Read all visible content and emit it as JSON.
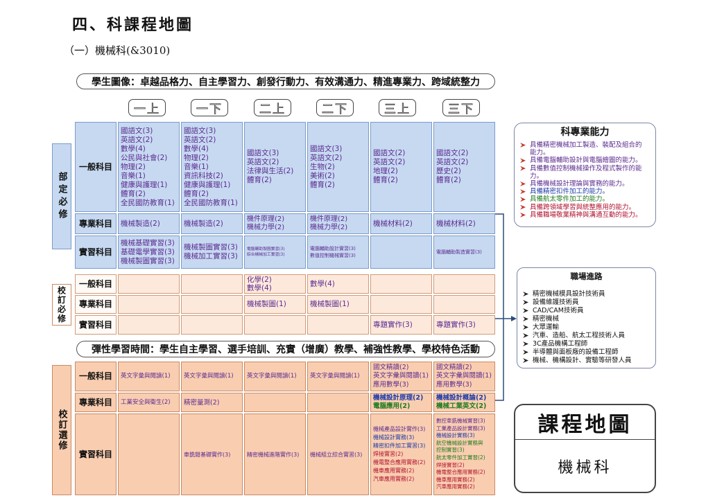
{
  "heading": "四、科課程地圖",
  "subheading": "（一）機械科(&3010)",
  "banner_top": "學生圖像：卓越品格力、自主學習力、創發行動力、有效溝通力、精進專業力、跨域統整力",
  "banner_mid": "彈性學習時間：學生自主學習、選手培訓、充實（增廣）教學、補強性教學、學校特色活動",
  "semesters": [
    "一上",
    "一下",
    "二上",
    "二下",
    "三上",
    "三下"
  ],
  "colors": {
    "purple": "#5b2c8f",
    "blue": "#1f3ba8",
    "green": "#1f7a1f",
    "red": "#b0122e",
    "black": "#111111"
  },
  "sections": [
    {
      "label": "部定必修",
      "rows": [
        {
          "label": "一般科目",
          "cells": [
            [
              "國語文(3)",
              "英語文(2)",
              "數學(4)",
              "公民與社會(2)",
              "物理(2)",
              "音樂(1)",
              "健康與護理(1)",
              "體育(2)",
              "全民國防教育(1)"
            ],
            [
              "國語文(3)",
              "英語文(2)",
              "數學(4)",
              "物理(2)",
              "音樂(1)",
              "資訊科技(2)",
              "健康與護理(1)",
              "體育(2)",
              "全民國防教育(1)"
            ],
            [
              "國語文(3)",
              "英語文(2)",
              "法律與生活(2)",
              "體育(2)"
            ],
            [
              "國語文(3)",
              "英語文(2)",
              "生物(2)",
              "美術(2)",
              "體育(2)"
            ],
            [
              "國語文(2)",
              "英語文(2)",
              "地理(2)",
              "體育(2)"
            ],
            [
              "國語文(2)",
              "英語文(2)",
              "歷史(2)",
              "體育(2)"
            ]
          ]
        },
        {
          "label": "專業科目",
          "cells": [
            [
              "機械製造(2)"
            ],
            [
              "機械製造(2)"
            ],
            [
              "機件原理(2)",
              "機械力學(2)"
            ],
            [
              "機件原理(2)",
              "機械力學(2)"
            ],
            [
              "機械材料(2)"
            ],
            [
              "機械材料(2)"
            ]
          ]
        },
        {
          "label": "實習科目",
          "cells": [
            [
              "機械基礎實習(3)",
              "基礎電學實習(3)",
              "機械製圖實習(3)"
            ],
            [
              "機械製圖實習(3)",
              "機械加工實習(3)"
            ],
            [
              "電腦輔助製圖實習(3)",
              "綜合機械加工實習(3)"
            ],
            [
              "電腦輔助設計實習(3)",
              "數值控制機械實習(3)"
            ],
            [],
            [
              "電腦輔助製造實習(3)"
            ]
          ]
        }
      ]
    },
    {
      "label": "校訂必修",
      "rows": [
        {
          "label": "一般科目",
          "cells": [
            [],
            [],
            [
              "化學(2)",
              "數學(4)"
            ],
            [
              "數學(4)"
            ],
            [],
            []
          ]
        },
        {
          "label": "專業科目",
          "cells": [
            [],
            [],
            [
              "機械製圖(1)"
            ],
            [
              "機械製圖(1)"
            ],
            [],
            []
          ]
        },
        {
          "label": "實習科目",
          "cells": [
            [],
            [],
            [],
            [],
            [
              "專題實作(3)"
            ],
            [
              "專題實作(3)"
            ]
          ]
        }
      ]
    },
    {
      "label": "校訂選修",
      "rows": [
        {
          "label": "一般科目",
          "cells": [
            [
              "英文字彙與閱讀(1)"
            ],
            [
              "英文字彙與閱讀(1)"
            ],
            [
              "英文字彙與閱讀(1)"
            ],
            [
              "英文字彙與閱讀(1)"
            ],
            [
              "國文精讀(2)",
              "英文字彙與閱讀(1)",
              "應用數學(3)"
            ],
            [
              "國文精讀(2)",
              "英文字彙與閱讀(1)",
              "應用數學(3)"
            ]
          ]
        },
        {
          "label": "專業科目",
          "cells": [
            [
              "工業安全與衛生(2)"
            ],
            [
              "精密量測(2)"
            ],
            [],
            [],
            [
              {
                "t": "機械設計原理(2)",
                "c": "blue"
              },
              {
                "t": "電腦應用(2)",
                "c": "green"
              }
            ],
            [
              {
                "t": "機械設計概論(2)",
                "c": "blue"
              },
              {
                "t": "機械工業英文(2)",
                "c": "green"
              }
            ]
          ]
        },
        {
          "label": "實習科目",
          "cells": [
            [],
            [
              "車銑鉗基礎實作(3)"
            ],
            [
              "精密機械進階實作(3)"
            ],
            [
              "機械組立綜合實習(3)"
            ],
            [
              {
                "t": "機械產品設計實作(3)",
                "c": "purple"
              },
              {
                "t": "機械設計實務(3)",
                "c": "blue"
              },
              {
                "t": "精密扣件加工實習(3)",
                "c": "blue"
              },
              {
                "t": "焊接實習(2)",
                "c": "red"
              },
              {
                "t": "機電整合應用實務(2)",
                "c": "red"
              },
              {
                "t": "機車應用實務(2)",
                "c": "red"
              },
              {
                "t": "汽車應用實務(2)",
                "c": "red"
              }
            ],
            [
              {
                "t": "數控車銑機械實習(3)",
                "c": "purple"
              },
              {
                "t": "工業產品設計實務(3)",
                "c": "purple"
              },
              {
                "t": "機械設計實務(3)",
                "c": "blue"
              },
              {
                "t": "航空機械設計實務與\n控制實習(3)",
                "c": "green"
              },
              {
                "t": "航太零件加工實習(2)",
                "c": "green"
              },
              {
                "t": "焊接實習(2)",
                "c": "red"
              },
              {
                "t": "機電整合應用實務(2)",
                "c": "red"
              },
              {
                "t": "機車應用實務(2)",
                "c": "red"
              },
              {
                "t": "汽車應用實務(2)",
                "c": "red"
              }
            ]
          ]
        }
      ]
    }
  ],
  "abilities": {
    "title": "科專業能力",
    "items": [
      {
        "t": "具備精密機械加工製造、裝配及組合的能力。",
        "c": "purple"
      },
      {
        "t": "具備電腦輔助設計與電腦繪圖的能力。",
        "c": "purple"
      },
      {
        "t": "具備數值控制機械操作及程式製作的能力。",
        "c": "purple"
      },
      {
        "t": "具備機械設計理論與實務的能力。",
        "c": "purple"
      },
      {
        "t": "具備精密扣件加工的能力。",
        "c": "blue"
      },
      {
        "t": "具備航太零件加工的能力。",
        "c": "green"
      },
      {
        "t": "具備跨領域學習與統整應用的能力。",
        "c": "red"
      },
      {
        "t": "具備職場敬業精神與溝通互動的能力。",
        "c": "red"
      }
    ]
  },
  "careers": {
    "title": "職場進路",
    "items": [
      {
        "t": "精密機械模具設計技術員"
      },
      {
        "t": "設備維護技術員"
      },
      {
        "t": "CAD/CAM技術員"
      },
      {
        "t": "精密機械"
      },
      {
        "t": "大眾運輸"
      },
      {
        "t": "汽車、造船、航太工程技術人員"
      },
      {
        "t": "3C產品機構工程師"
      },
      {
        "t": "半導體與面板廠的設備工程師"
      },
      {
        "t": "機械、機構設計、實驗等研發人員"
      }
    ]
  },
  "course_map": {
    "title": "課程地圖",
    "dept": "機械科"
  }
}
